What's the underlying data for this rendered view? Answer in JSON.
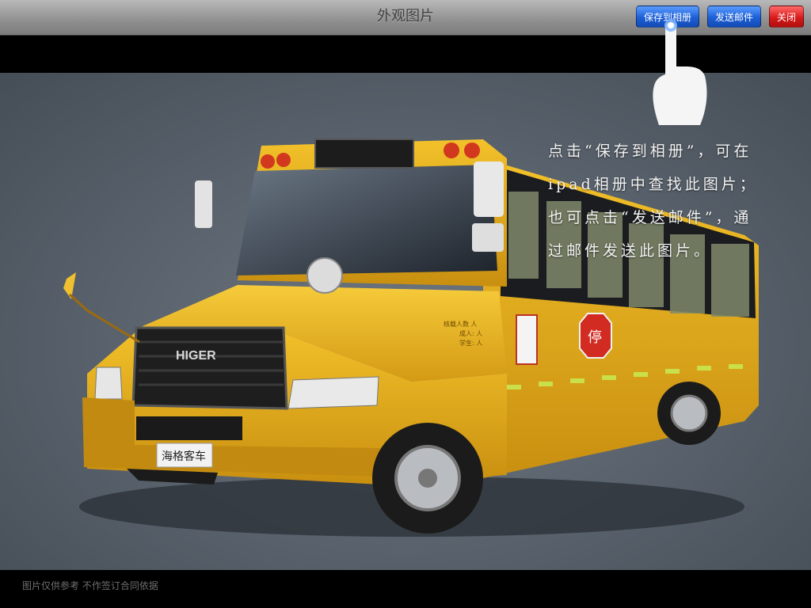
{
  "header": {
    "title": "外观图片",
    "save_label": "保存到相册",
    "mail_label": "发送邮件",
    "close_label": "关闭"
  },
  "hint": {
    "lines": [
      "点击“保存到相册”，可在",
      "ipad相册中查找此图片；",
      "也可点击“发送邮件”，通",
      "过邮件发送此图片。"
    ]
  },
  "bus": {
    "brand_badge": "HIGER",
    "plate": "海格客车",
    "stop_sign": "停",
    "side_info": [
      "核载人数    人",
      "成人:      人",
      "学生:      人"
    ]
  },
  "footer": {
    "disclaimer": "图片仅供参考  不作签订合同依据"
  },
  "colors": {
    "bus_yellow": "#e8b21a",
    "button_blue": "#1c5fd6",
    "button_red": "#d81a1a"
  },
  "icons": {
    "pointer": "hand-pointer-icon"
  }
}
